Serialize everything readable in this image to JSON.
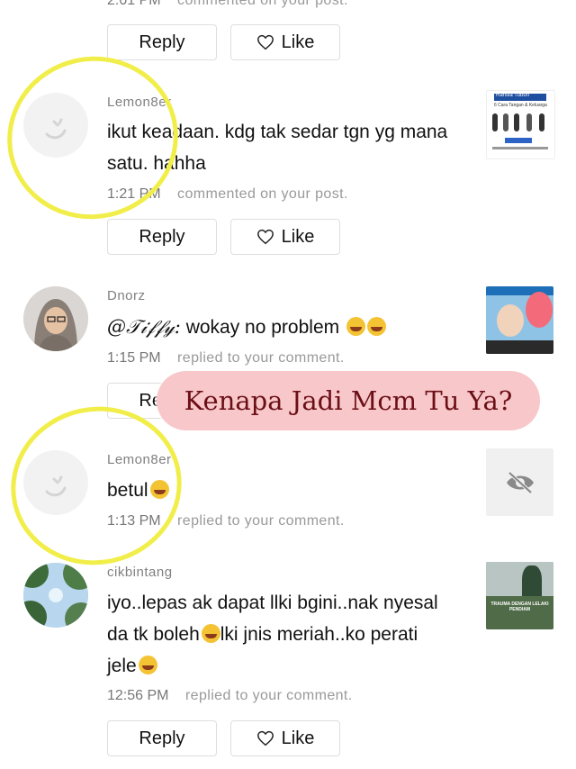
{
  "buttons": {
    "reply": "Reply",
    "like": "Like"
  },
  "top": {
    "time": "2:01 PM",
    "action": "commented on your post."
  },
  "comments": [
    {
      "user": "Lemon8er",
      "text": "ikut keadaan. kdg tak sedar tgn yg mana satu. hahha",
      "time": "1:21 PM",
      "action": "commented on your post."
    },
    {
      "user": "Dnorz",
      "mention": "@𝒯𝒾𝒻𝒻𝓎:",
      "text": "wokay no problem",
      "time": "1:15 PM",
      "action": "replied to your comment."
    },
    {
      "user": "Lemon8er",
      "text": "betul",
      "time": "1:13 PM",
      "action": "replied to your comment."
    },
    {
      "user": "cikbintang",
      "text_line1": "iyo..lepas ak dapat llki bgini..nak nyesal",
      "text_line2a": "da tk boleh",
      "text_line2b": "lki jnis meriah..ko perati",
      "text_line3": "jele",
      "time": "12:56 PM",
      "action": "replied to your comment."
    }
  ],
  "thumbs": {
    "t1_title": "Rahsia Tubuh",
    "t1_sub": "6 Cara Tangan & Keluarga",
    "t4_caption": "TRAUMA DENGAN LELAKI PENDIAM"
  },
  "overlay": {
    "banner": "Kenapa Jadi Mcm Tu Ya?"
  },
  "colors": {
    "highlight": "#f1ee4a",
    "banner_bg": "#f8c7c9",
    "banner_text": "#6b0f17"
  }
}
